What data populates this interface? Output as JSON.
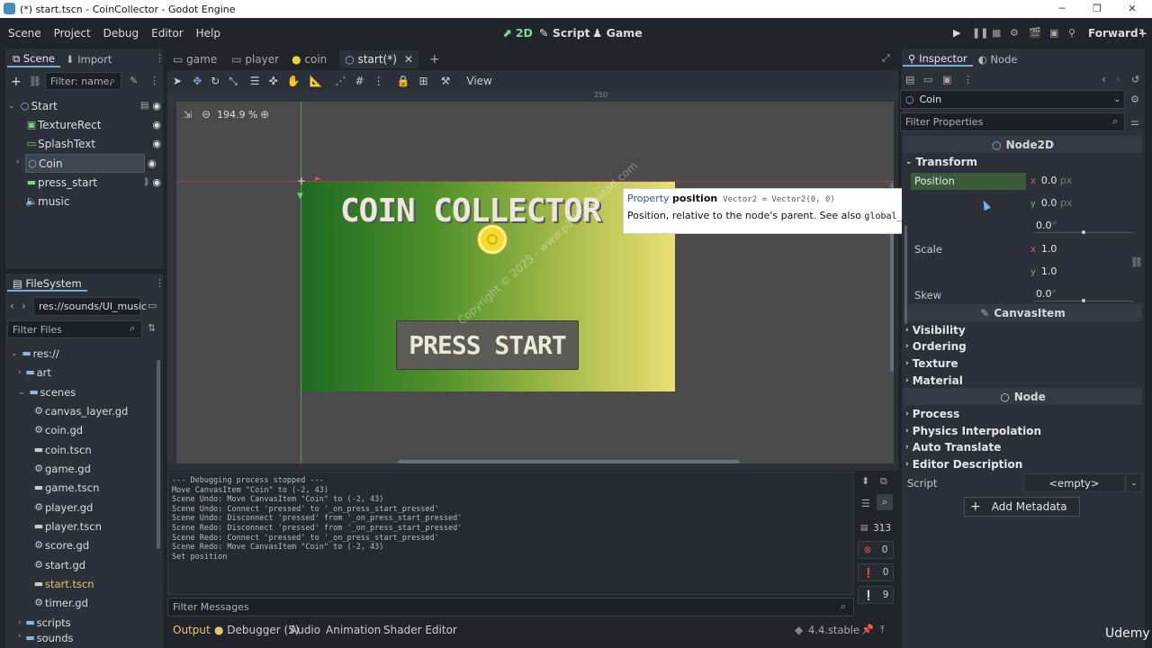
{
  "window": {
    "title": "(*) start.tscn - CoinCollector - Godot Engine"
  },
  "menu": [
    "Scene",
    "Project",
    "Debug",
    "Editor",
    "Help"
  ],
  "workspaces": [
    {
      "label": "2D",
      "active": true
    },
    {
      "label": "Script",
      "active": false
    },
    {
      "label": "Game",
      "active": false
    }
  ],
  "renderer": "Forward+",
  "scene_dock": {
    "tabs": [
      "Scene",
      "Import"
    ],
    "filter_placeholder": "Filter: name,",
    "tree": [
      "Start",
      "TextureRect",
      "SplashText",
      "Coin",
      "press_start",
      "music"
    ],
    "selected": "Coin"
  },
  "filesystem": {
    "title": "FileSystem",
    "path": "res://sounds/UI_music",
    "filter_placeholder": "Filter Files",
    "items": [
      {
        "label": "res://",
        "type": "folder"
      },
      {
        "label": "art",
        "type": "folder"
      },
      {
        "label": "scenes",
        "type": "folder"
      },
      {
        "label": "canvas_layer.gd",
        "type": "script"
      },
      {
        "label": "coin.gd",
        "type": "script"
      },
      {
        "label": "coin.tscn",
        "type": "scene"
      },
      {
        "label": "game.gd",
        "type": "script"
      },
      {
        "label": "game.tscn",
        "type": "scene"
      },
      {
        "label": "player.gd",
        "type": "script"
      },
      {
        "label": "player.tscn",
        "type": "scene"
      },
      {
        "label": "score.gd",
        "type": "script"
      },
      {
        "label": "start.gd",
        "type": "script"
      },
      {
        "label": "start.tscn",
        "type": "scene"
      },
      {
        "label": "timer.gd",
        "type": "script"
      },
      {
        "label": "scripts",
        "type": "folder"
      },
      {
        "label": "sounds",
        "type": "folder"
      }
    ]
  },
  "editor_tabs": [
    "game",
    "player",
    "coin",
    "start(*)"
  ],
  "toolbar": {
    "view": "View"
  },
  "viewport": {
    "zoom": "194.9 %",
    "ruler_mark": "250",
    "splash_text": "COIN COLLECTOR",
    "button_text": "PRESS START",
    "watermark1": "Copyright © 2025 - www.p30download.com"
  },
  "tooltip": {
    "kind": "Property",
    "name": "position",
    "type": "Vector2 = Vector2(0, 0)",
    "desc_pre": "Position, relative to the node's parent. See also ",
    "desc_code": "global_position",
    "desc_post": "."
  },
  "output": {
    "lines": [
      "--- Debugging process stopped ---",
      "Move CanvasItem \"Coin\" to (-2, 43)",
      "Scene Undo: Move CanvasItem \"Coin\" to (-2, 43)",
      "Scene Undo: Connect 'pressed' to '_on_press_start_pressed'",
      "Scene Undo: Disconnect 'pressed' from '_on_press_start_pressed'",
      "Scene Redo: Disconnect 'pressed' from '_on_press_start_pressed'",
      "Scene Redo: Connect 'pressed' to '_on_press_start_pressed'",
      "Scene Redo: Move CanvasItem \"Coin\" to (-2, 43)",
      "Set position"
    ],
    "count": "313",
    "errors": "0",
    "warnings": "0",
    "messages": "9",
    "filter_placeholder": "Filter Messages"
  },
  "bottom_tabs": [
    "Output",
    "Debugger (5)",
    "Audio",
    "Animation",
    "Shader Editor"
  ],
  "version": "4.4.stable",
  "inspector": {
    "tabs": [
      "Inspector",
      "Node"
    ],
    "object": "Coin",
    "filter_placeholder": "Filter Properties",
    "class_node2d": "Node2D",
    "transform": "Transform",
    "position_label": "Position",
    "pos_x": "0.0",
    "pos_y": "0.0",
    "unit": "px",
    "rotation": "0.0",
    "deg": "°",
    "scale_label": "Scale",
    "scale_x": "1.0",
    "scale_y": "1.0",
    "skew_label": "Skew",
    "skew": "0.0",
    "class_canvas": "CanvasItem",
    "canvas_sections": [
      "Visibility",
      "Ordering",
      "Texture",
      "Material"
    ],
    "class_node": "Node",
    "node_sections": [
      "Process",
      "Physics Interpolation",
      "Auto Translate",
      "Editor Description"
    ],
    "script_label": "Script",
    "script_value": "<empty>",
    "add_metadata": "Add Metadata"
  },
  "udemy": "Udemy",
  "colors": {
    "accent": "#7ed6a0",
    "selection": "#3e4650",
    "tooltip_bg": "#ffffff"
  }
}
